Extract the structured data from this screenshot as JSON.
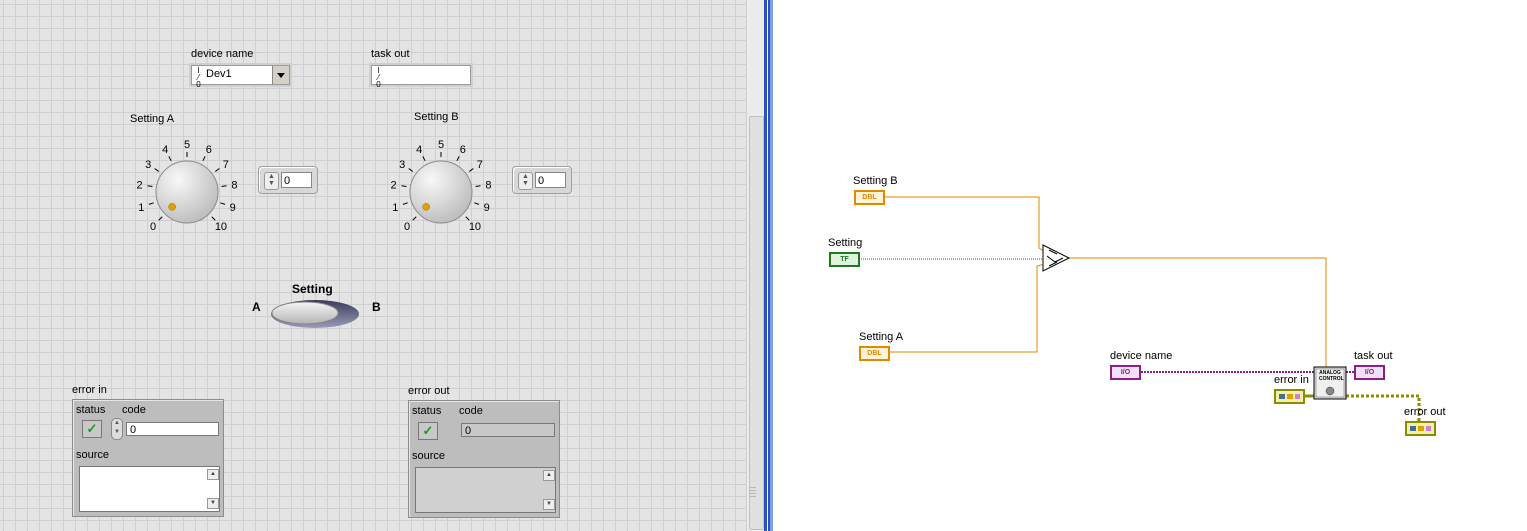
{
  "front_panel": {
    "device_name": {
      "label": "device name",
      "value": "Dev1",
      "io_glyph": "I/0"
    },
    "task_out": {
      "label": "task out",
      "value": "",
      "io_glyph": "I/0"
    },
    "setting_a": {
      "label": "Setting A",
      "ticks": [
        "0",
        "1",
        "2",
        "3",
        "4",
        "5",
        "6",
        "7",
        "8",
        "9",
        "10"
      ],
      "value": "0"
    },
    "setting_b": {
      "label": "Setting B",
      "ticks": [
        "0",
        "1",
        "2",
        "3",
        "4",
        "5",
        "6",
        "7",
        "8",
        "9",
        "10"
      ],
      "value": "0"
    },
    "setting_switch": {
      "label": "Setting",
      "left": "A",
      "right": "B"
    },
    "error_in": {
      "label": "error in",
      "status_label": "status",
      "code_label": "code",
      "code_value": "0",
      "source_label": "source",
      "status_mark": "✓"
    },
    "error_out": {
      "label": "error out",
      "status_label": "status",
      "code_label": "code",
      "code_value": "0",
      "source_label": "source",
      "status_mark": "✓"
    }
  },
  "block_diagram": {
    "setting_b": {
      "label": "Setting B",
      "type": "DBL"
    },
    "setting": {
      "label": "Setting",
      "type": "TF"
    },
    "setting_a": {
      "label": "Setting A",
      "type": "DBL"
    },
    "device_name": {
      "label": "device name",
      "type": "I/O"
    },
    "task_out": {
      "label": "task out",
      "type": "I/O"
    },
    "error_in": {
      "label": "error in"
    },
    "error_out": {
      "label": "error out"
    },
    "subvi": {
      "line1": "ANALOG",
      "line2": "CONTROL"
    }
  },
  "colors": {
    "dbl_orange": "#e08a00",
    "bool_green": "#1f7a1f",
    "io_purple": "#8a1f8a",
    "cluster_olive": "#8c8c00",
    "knob_dot": "#e0a000",
    "splitter_blue": "#2a52be"
  }
}
